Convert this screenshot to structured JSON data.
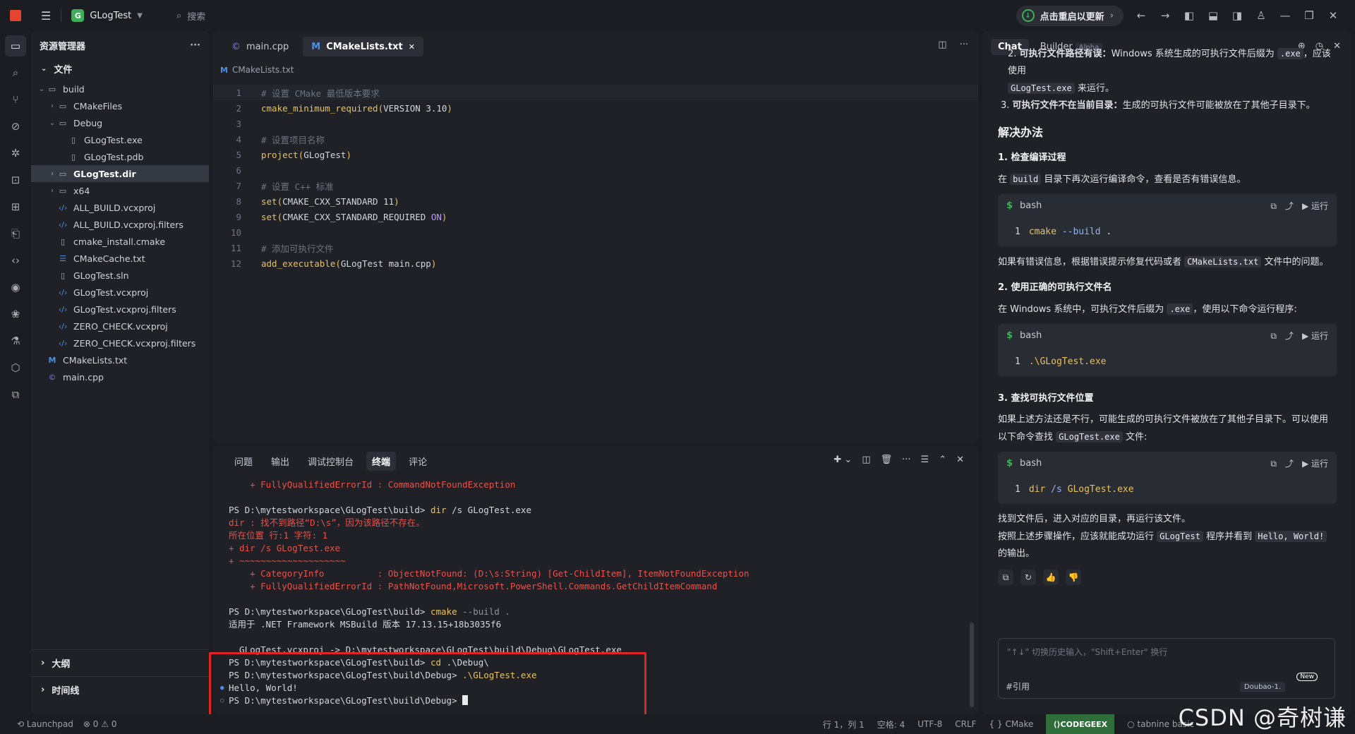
{
  "titlebar": {
    "project_name": "GLogTest",
    "project_initial": "G",
    "search_label": "搜索",
    "restart_label": "点击重启以更新"
  },
  "explorer": {
    "title": "资源管理器",
    "section_files": "文件",
    "items": [
      {
        "label": "build",
        "depth": 0,
        "type": "folder",
        "state": "open"
      },
      {
        "label": "CMakeFiles",
        "depth": 1,
        "type": "folder",
        "state": "closed"
      },
      {
        "label": "Debug",
        "depth": 1,
        "type": "folder",
        "state": "open"
      },
      {
        "label": "GLogTest.exe",
        "depth": 2,
        "type": "doc"
      },
      {
        "label": "GLogTest.pdb",
        "depth": 2,
        "type": "doc"
      },
      {
        "label": "GLogTest.dir",
        "depth": 1,
        "type": "folder",
        "state": "closed",
        "selected": true
      },
      {
        "label": "x64",
        "depth": 1,
        "type": "folder",
        "state": "closed"
      },
      {
        "label": "ALL_BUILD.vcxproj",
        "depth": 1,
        "type": "xml"
      },
      {
        "label": "ALL_BUILD.vcxproj.filters",
        "depth": 1,
        "type": "xml"
      },
      {
        "label": "cmake_install.cmake",
        "depth": 1,
        "type": "doc"
      },
      {
        "label": "CMakeCache.txt",
        "depth": 1,
        "type": "lines"
      },
      {
        "label": "GLogTest.sln",
        "depth": 1,
        "type": "doc"
      },
      {
        "label": "GLogTest.vcxproj",
        "depth": 1,
        "type": "xml"
      },
      {
        "label": "GLogTest.vcxproj.filters",
        "depth": 1,
        "type": "xml"
      },
      {
        "label": "ZERO_CHECK.vcxproj",
        "depth": 1,
        "type": "xml"
      },
      {
        "label": "ZERO_CHECK.vcxproj.filters",
        "depth": 1,
        "type": "xml"
      },
      {
        "label": "CMakeLists.txt",
        "depth": 0,
        "type": "cmake"
      },
      {
        "label": "main.cpp",
        "depth": 0,
        "type": "cpp"
      }
    ],
    "outline_label": "大纲",
    "timeline_label": "时间线"
  },
  "editor": {
    "tabs": [
      {
        "label": "main.cpp",
        "active": false
      },
      {
        "label": "CMakeLists.txt",
        "active": true
      }
    ],
    "breadcrumb": "CMakeLists.txt",
    "lines": [
      {
        "n": "1",
        "tokens": [
          [
            "cm",
            "# 设置 CMake 最低版本要求"
          ]
        ]
      },
      {
        "n": "2",
        "tokens": [
          [
            "fn",
            "cmake_minimum_required"
          ],
          [
            "pn",
            "("
          ],
          [
            "cst",
            "VERSION 3.10"
          ],
          [
            "pn",
            ")"
          ]
        ]
      },
      {
        "n": "3",
        "tokens": []
      },
      {
        "n": "4",
        "tokens": [
          [
            "cm",
            "# 设置项目名称"
          ]
        ]
      },
      {
        "n": "5",
        "tokens": [
          [
            "fn",
            "project"
          ],
          [
            "pn",
            "("
          ],
          [
            "cst",
            "GLogTest"
          ],
          [
            "pn",
            ")"
          ]
        ]
      },
      {
        "n": "6",
        "tokens": []
      },
      {
        "n": "7",
        "tokens": [
          [
            "cm",
            "# 设置 C++ 标准"
          ]
        ]
      },
      {
        "n": "8",
        "tokens": [
          [
            "fn",
            "set"
          ],
          [
            "pn",
            "("
          ],
          [
            "cst",
            "CMAKE_CXX_STANDARD 11"
          ],
          [
            "pn",
            ")"
          ]
        ]
      },
      {
        "n": "9",
        "tokens": [
          [
            "fn",
            "set"
          ],
          [
            "pn",
            "("
          ],
          [
            "cst",
            "CMAKE_CXX_STANDARD_REQUIRED "
          ],
          [
            "kw",
            "ON"
          ],
          [
            "pn",
            ")"
          ]
        ]
      },
      {
        "n": "10",
        "tokens": []
      },
      {
        "n": "11",
        "tokens": [
          [
            "cm",
            "# 添加可执行文件"
          ]
        ]
      },
      {
        "n": "12",
        "tokens": [
          [
            "fn",
            "add_executable"
          ],
          [
            "pn",
            "("
          ],
          [
            "cst",
            "GLogTest main.cpp"
          ],
          [
            "pn",
            ")"
          ]
        ]
      }
    ]
  },
  "panel": {
    "tabs": [
      "问题",
      "输出",
      "调试控制台",
      "终端",
      "评论"
    ],
    "active_tab": "终端",
    "terminal_lines": [
      [
        [
          "red",
          "    + FullyQualifiedErrorId : CommandNotFoundException"
        ]
      ],
      [
        [
          "",
          " "
        ]
      ],
      [
        [
          "",
          "PS D:\\mytestworkspace\\GLogTest\\build> "
        ],
        [
          "yel",
          "dir"
        ],
        [
          "",
          " /s GLogTest.exe"
        ]
      ],
      [
        [
          "red",
          "dir : 找不到路径“D:\\s”，因为该路径不存在。"
        ]
      ],
      [
        [
          "red",
          "所在位置 行:1 字符: 1"
        ]
      ],
      [
        [
          "red",
          "+ dir /s GLogTest.exe"
        ]
      ],
      [
        [
          "red",
          "+ ~~~~~~~~~~~~~~~~~~~~"
        ]
      ],
      [
        [
          "red",
          "    + CategoryInfo          : ObjectNotFound: (D:\\s:String) [Get-ChildItem], ItemNotFoundException"
        ]
      ],
      [
        [
          "red",
          "    + FullyQualifiedErrorId : PathNotFound,Microsoft.PowerShell.Commands.GetChildItemCommand"
        ]
      ],
      [
        [
          "",
          " "
        ]
      ],
      [
        [
          "",
          "PS D:\\mytestworkspace\\GLogTest\\build> "
        ],
        [
          "yel",
          "cmake"
        ],
        [
          "gry",
          " --build ."
        ]
      ],
      [
        [
          "",
          "适用于 .NET Framework MSBuild 版本 17.13.15+18b3035f6"
        ]
      ],
      [
        [
          "",
          " "
        ]
      ],
      [
        [
          "",
          "  GLogTest.vcxproj -> D:\\mytestworkspace\\GLogTest\\build\\Debug\\GLogTest.exe"
        ]
      ],
      [
        [
          "",
          "PS D:\\mytestworkspace\\GLogTest\\build> "
        ],
        [
          "yel",
          "cd"
        ],
        [
          "",
          " .\\Debug\\"
        ]
      ],
      [
        [
          "",
          "PS D:\\mytestworkspace\\GLogTest\\build\\Debug> "
        ],
        [
          "yel",
          ".\\GLogTest.exe"
        ]
      ],
      [
        [
          "",
          "Hello, World!"
        ]
      ],
      [
        [
          "",
          "PS D:\\mytestworkspace\\GLogTest\\build\\Debug> "
        ]
      ]
    ]
  },
  "chat": {
    "tabs": [
      {
        "label": "Chat"
      },
      {
        "label": "Builder",
        "badge": "Alpha"
      }
    ],
    "item2_bold": "可执行文件路径有误：",
    "item2_text": "Windows 系统生成的可执行文件后缀为",
    "item2_code": ".exe",
    "item2_text2": "，应该使用",
    "item2_code2": "GLogTest.exe",
    "item2_text3": "来运行。",
    "item3_num": "3.",
    "item3_bold": "可执行文件不在当前目录：",
    "item3_text": "生成的可执行文件可能被放在了其他子目录下。",
    "solution_title": "解决办法",
    "s1_title": "1. 检查编译过程",
    "s1_text_a": "在",
    "s1_code": "build",
    "s1_text_b": "目录下再次运行编译命令，查看是否有错误信息。",
    "code1": {
      "lang": "bash",
      "line": "1",
      "cmd": "cmake",
      "args": "--build",
      "rest": "."
    },
    "s1_after_a": "如果有错误信息，根据错误提示修复代码或者",
    "s1_after_code": "CMakeLists.txt",
    "s1_after_b": "文件中的问题。",
    "s2_title": "2. 使用正确的可执行文件名",
    "s2_text_a": "在 Windows 系统中，可执行文件后缀为",
    "s2_code": ".exe",
    "s2_text_b": "，使用以下命令运行程序:",
    "code2": {
      "lang": "bash",
      "line": "1",
      "text": ".\\GLogTest.exe"
    },
    "s3_title": "3. 查找可执行文件位置",
    "s3_text_a": "如果上述方法还是不行，可能生成的可执行文件被放在了其他子目录下。可以使用以下命令查找",
    "s3_code": "GLogTest.exe",
    "s3_text_b": "文件:",
    "code3": {
      "lang": "bash",
      "line": "1",
      "cmd": "dir",
      "args": "/s",
      "rest": "GLogTest.exe"
    },
    "final_1": "找到文件后，进入对应的目录，再运行该文件。",
    "final_2a": "按照上述步骤操作，应该就能成功运行",
    "final_2code": "GLogTest",
    "final_2b": "程序并看到",
    "final_2code2": "Hello, World!",
    "final_2c": "的输出。",
    "copy_label": "复制",
    "insert_label": "插入",
    "run_label": "运行",
    "input_placeholder": "\"↑↓\" 切换历史输入，\"Shift+Enter\" 换行",
    "input_ref": "#引用",
    "model_label": "Doubao-1.",
    "new_badge": "New"
  },
  "statusbar": {
    "launchpad": "Launchpad",
    "errors": "0",
    "warnings": "0",
    "position": "行 1，列 1",
    "spaces": "空格: 4",
    "encoding": "UTF-8",
    "eol": "CRLF",
    "language": "CMake",
    "codegeex": "CODEGEEX",
    "tabnine": "tabnine basic",
    "watermark": "CSDN @奇树谦"
  }
}
